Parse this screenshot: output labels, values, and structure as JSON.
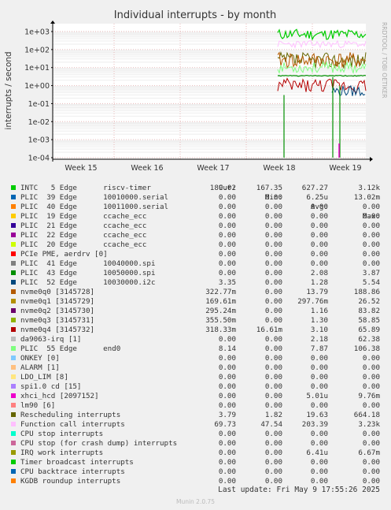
{
  "chart_data": {
    "type": "line",
    "title": "Individual interrupts - by month",
    "ylabel": "interrupts / second",
    "yscale": "log",
    "ylim": [
      0.0001,
      3000
    ],
    "y_ticks": [
      "1e+03",
      "1e+02",
      "1e+01",
      "1e+00",
      "1e-01",
      "1e-02",
      "1e-03",
      "1e-04"
    ],
    "x_ticks": [
      "Week 15",
      "Week 16",
      "Week 17",
      "Week 18",
      "Week 19"
    ],
    "side_label": "RRDTOOL / TOBI OETIKER",
    "legend_headers": {
      "cur": "Cur:",
      "min": "Min:",
      "avg": "Avg:",
      "max": "Max:"
    },
    "series": [
      {
        "name": "INTC   5 Edge      riscv-timer",
        "color": "#00cc00",
        "cur": "189.02",
        "min": "167.35",
        "avg": "627.27",
        "max": "3.12k"
      },
      {
        "name": "PLIC  39 Edge      10010000.serial",
        "color": "#0066b3",
        "cur": "0.00",
        "min": "0.00",
        "avg": "6.25u",
        "max": "13.02m"
      },
      {
        "name": "PLIC  40 Edge      10011000.serial",
        "color": "#ff8000",
        "cur": "0.00",
        "min": "0.00",
        "avg": "0.00",
        "max": "0.00"
      },
      {
        "name": "PLIC  19 Edge      ccache_ecc",
        "color": "#ffcc00",
        "cur": "0.00",
        "min": "0.00",
        "avg": "0.00",
        "max": "0.00"
      },
      {
        "name": "PLIC  21 Edge      ccache_ecc",
        "color": "#330099",
        "cur": "0.00",
        "min": "0.00",
        "avg": "0.00",
        "max": "0.00"
      },
      {
        "name": "PLIC  22 Edge      ccache_ecc",
        "color": "#990099",
        "cur": "0.00",
        "min": "0.00",
        "avg": "0.00",
        "max": "0.00"
      },
      {
        "name": "PLIC  20 Edge      ccache_ecc",
        "color": "#ccff00",
        "cur": "0.00",
        "min": "0.00",
        "avg": "0.00",
        "max": "0.00"
      },
      {
        "name": "PCIe PME, aerdrv [0]",
        "color": "#ff0000",
        "cur": "0.00",
        "min": "0.00",
        "avg": "0.00",
        "max": "0.00"
      },
      {
        "name": "PLIC  41 Edge      10040000.spi",
        "color": "#808080",
        "cur": "0.00",
        "min": "0.00",
        "avg": "0.00",
        "max": "0.00"
      },
      {
        "name": "PLIC  43 Edge      10050000.spi",
        "color": "#008f00",
        "cur": "0.00",
        "min": "0.00",
        "avg": "2.08",
        "max": "3.87"
      },
      {
        "name": "PLIC  52 Edge      10030000.i2c",
        "color": "#00487d",
        "cur": "3.35",
        "min": "0.00",
        "avg": "1.28",
        "max": "5.54"
      },
      {
        "name": "nvme0q0 [3145728]",
        "color": "#b35a00",
        "cur": "322.77m",
        "min": "0.00",
        "avg": "13.79",
        "max": "188.86"
      },
      {
        "name": "nvme0q1 [3145729]",
        "color": "#b38f00",
        "cur": "169.61m",
        "min": "0.00",
        "avg": "297.76m",
        "max": "26.52"
      },
      {
        "name": "nvme0q2 [3145730]",
        "color": "#6b006b",
        "cur": "295.24m",
        "min": "0.00",
        "avg": "1.16",
        "max": "83.82"
      },
      {
        "name": "nvme0q3 [3145731]",
        "color": "#8fb300",
        "cur": "355.50m",
        "min": "0.00",
        "avg": "1.30",
        "max": "58.85"
      },
      {
        "name": "nvme0q4 [3145732]",
        "color": "#b30000",
        "cur": "318.33m",
        "min": "16.61m",
        "avg": "3.10",
        "max": "65.89"
      },
      {
        "name": "da9063-irq [1]",
        "color": "#bebebe",
        "cur": "0.00",
        "min": "0.00",
        "avg": "2.18",
        "max": "62.38"
      },
      {
        "name": "PLIC  55 Edge      end0",
        "color": "#80ff80",
        "cur": "8.14",
        "min": "0.00",
        "avg": "7.87",
        "max": "106.38"
      },
      {
        "name": "ONKEY [0]",
        "color": "#80c9ff",
        "cur": "0.00",
        "min": "0.00",
        "avg": "0.00",
        "max": "0.00"
      },
      {
        "name": "ALARM [1]",
        "color": "#ffc080",
        "cur": "0.00",
        "min": "0.00",
        "avg": "0.00",
        "max": "0.00"
      },
      {
        "name": "LDO_LIM [8]",
        "color": "#ffe680",
        "cur": "0.00",
        "min": "0.00",
        "avg": "0.00",
        "max": "0.00"
      },
      {
        "name": "spi1.0 cd [15]",
        "color": "#aa80ff",
        "cur": "0.00",
        "min": "0.00",
        "avg": "0.00",
        "max": "0.00"
      },
      {
        "name": "xhci_hcd [2097152]",
        "color": "#ee00cc",
        "cur": "0.00",
        "min": "0.00",
        "avg": "5.01u",
        "max": "9.76m"
      },
      {
        "name": "lm90 [6]",
        "color": "#ff8080",
        "cur": "0.00",
        "min": "0.00",
        "avg": "0.00",
        "max": "0.00"
      },
      {
        "name": "Rescheduling interrupts",
        "color": "#666600",
        "cur": "3.79",
        "min": "1.82",
        "avg": "19.63",
        "max": "664.18"
      },
      {
        "name": "Function call interrupts",
        "color": "#ffbfff",
        "cur": "69.73",
        "min": "47.54",
        "avg": "203.39",
        "max": "3.23k"
      },
      {
        "name": "CPU stop interrupts",
        "color": "#00ffcc",
        "cur": "0.00",
        "min": "0.00",
        "avg": "0.00",
        "max": "0.00"
      },
      {
        "name": "CPU stop (for crash dump) interrupts",
        "color": "#cc6699",
        "cur": "0.00",
        "min": "0.00",
        "avg": "0.00",
        "max": "0.00"
      },
      {
        "name": "IRQ work interrupts",
        "color": "#999900",
        "cur": "0.00",
        "min": "0.00",
        "avg": "6.41u",
        "max": "6.67m"
      },
      {
        "name": "Timer broadcast interrupts",
        "color": "#00cc00",
        "cur": "0.00",
        "min": "0.00",
        "avg": "0.00",
        "max": "0.00"
      },
      {
        "name": "CPU backtrace interrupts",
        "color": "#0066b3",
        "cur": "0.00",
        "min": "0.00",
        "avg": "0.00",
        "max": "0.00"
      },
      {
        "name": "KGDB roundup interrupts",
        "color": "#ff8000",
        "cur": "0.00",
        "min": "0.00",
        "avg": "0.00",
        "max": "0.00"
      }
    ]
  },
  "footer": {
    "last_update": "Last update: Fri May  9 17:55:26 2025",
    "munin": "Munin 2.0.75"
  }
}
